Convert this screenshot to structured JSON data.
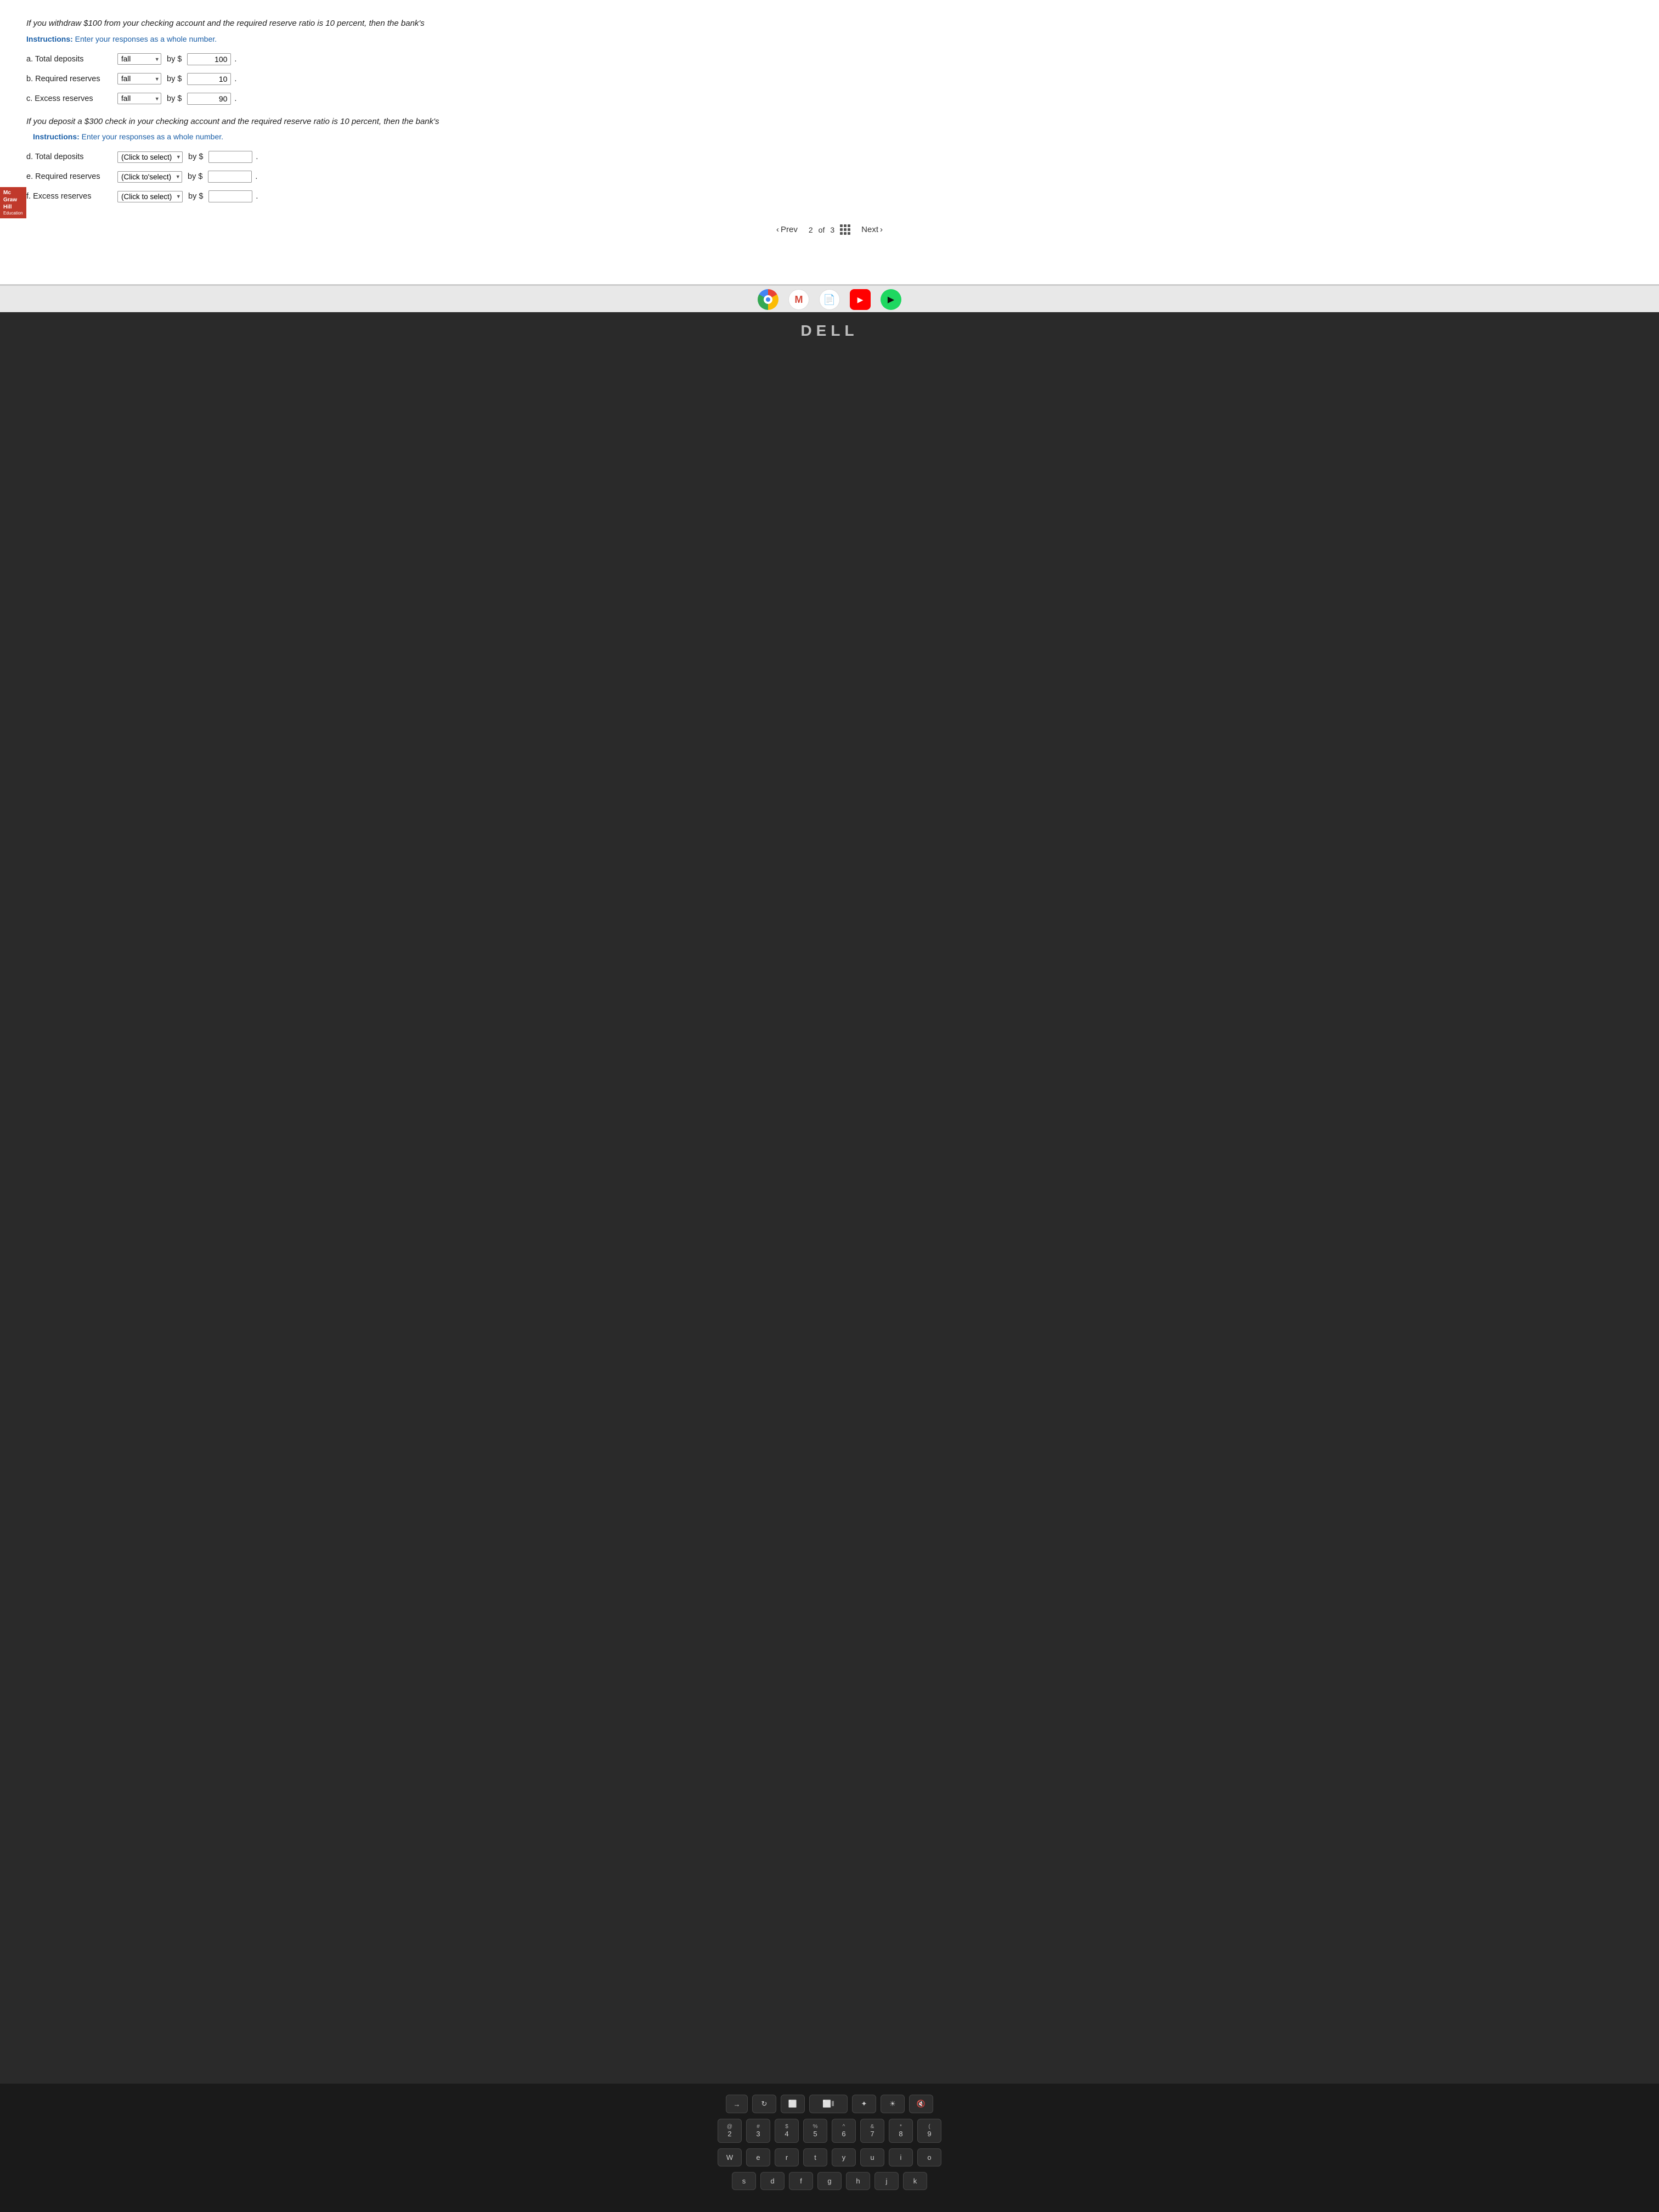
{
  "header": {
    "intro_line1": "If you withdraw $100 from your checking account and the required reserve ratio is 10 percent, then the bank's",
    "instructions1_label": "Instructions:",
    "instructions1_text": " Enter your responses as a whole number.",
    "question_a_label": "a. Total deposits",
    "question_b_label": "b. Required reserves",
    "question_c_label": "c. Excess reserves",
    "by_dollar": "by $",
    "period": ".",
    "answer_a": "100",
    "answer_b": "10",
    "answer_c": "90",
    "dropdown_a": "fall",
    "dropdown_b": "fall",
    "dropdown_c": "fall",
    "section2_intro": "If you deposit a $300 check in your checking account and the required reserve ratio is 10 percent, then the bank's",
    "instructions2_label": "Instructions:",
    "instructions2_text": " Enter your responses as a whole number.",
    "question_d_label": "d. Total deposits",
    "question_e_label": "e. Required reserves",
    "question_f_label": "f. Excess reserves",
    "dropdown_d_placeholder": "(Click to select)",
    "dropdown_e_placeholder": "(Click to'select)",
    "dropdown_f_placeholder": "(Click to select)"
  },
  "navigation": {
    "prev_label": "Prev",
    "page_current": "2",
    "page_of": "of",
    "page_total": "3",
    "next_label": "Next"
  },
  "taskbar": {
    "icons": [
      "chrome",
      "gmail",
      "files",
      "youtube",
      "play"
    ]
  },
  "dell_brand": "DELL",
  "keyboard": {
    "row1_keys": [
      {
        "top": "",
        "bottom": "→"
      },
      {
        "top": "",
        "bottom": "C"
      },
      {
        "top": "",
        "bottom": "⬜"
      },
      {
        "top": "",
        "bottom": "⬜‖"
      },
      {
        "top": "",
        "bottom": "✦"
      },
      {
        "top": "",
        "bottom": "☀"
      },
      {
        "top": "",
        "bottom": "⚙"
      }
    ],
    "row2_keys": [
      {
        "top": "@",
        "bottom": "2"
      },
      {
        "top": "#",
        "bottom": "3"
      },
      {
        "top": "$",
        "bottom": "4"
      },
      {
        "top": "%",
        "bottom": "5"
      },
      {
        "top": "^",
        "bottom": "6"
      },
      {
        "top": "&",
        "bottom": "7"
      },
      {
        "top": "*",
        "bottom": "8"
      },
      {
        "top": "(",
        "bottom": "9"
      }
    ],
    "row3_keys": [
      {
        "top": "",
        "bottom": "W"
      },
      {
        "top": "",
        "bottom": "e"
      },
      {
        "top": "",
        "bottom": "r"
      },
      {
        "top": "",
        "bottom": "t"
      },
      {
        "top": "",
        "bottom": "y"
      },
      {
        "top": "",
        "bottom": "u"
      },
      {
        "top": "",
        "bottom": "i"
      },
      {
        "top": "",
        "bottom": "o"
      }
    ],
    "row4_keys": [
      {
        "top": "",
        "bottom": "s"
      },
      {
        "top": "",
        "bottom": "d"
      },
      {
        "top": "",
        "bottom": "f"
      },
      {
        "top": "",
        "bottom": "g"
      },
      {
        "top": "",
        "bottom": "h"
      },
      {
        "top": "",
        "bottom": "j"
      },
      {
        "top": "",
        "bottom": "k"
      }
    ]
  },
  "mcgraw": {
    "line1": "Mc",
    "line2": "Graw",
    "line3": "Hill",
    "line4": "Education"
  }
}
